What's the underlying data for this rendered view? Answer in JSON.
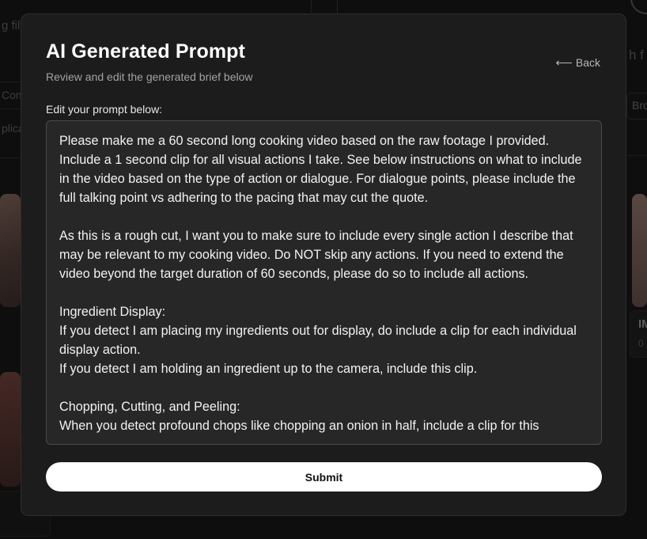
{
  "background": {
    "texts": [
      "g fil",
      "Con",
      "plica",
      "h f",
      "Bro",
      "IM",
      "0"
    ]
  },
  "modal": {
    "title": "AI Generated Prompt",
    "subtitle": "Review and edit the generated brief below",
    "back_label": "Back",
    "back_icon": "arrow-left-icon",
    "field_label": "Edit your prompt below:",
    "prompt_text": "Please make me a 60 second long cooking video based on the raw footage I provided. Include a 1 second clip for all visual actions I take. See below instructions on what to include in the video based on the type of action or dialogue. For dialogue points, please include the full talking point vs adhering to the pacing that may cut the quote.\n\nAs this is a rough cut, I want you to make sure to include every single action I describe that may be relevant to my cooking video. Do NOT skip any actions. If you need to extend the video beyond the target duration of 60 seconds, please do so to include all actions.\n\nIngredient Display:\nIf you detect I am placing my ingredients out for display, do include a clip for each individual display action.\nIf you detect I am holding an ingredient up to the camera, include this clip.\n\nChopping, Cutting, and Peeling:\nWhen you detect profound chops like chopping an onion in half, include a clip for this",
    "submit_label": "Submit"
  },
  "colors": {
    "modal_bg": "#1c1c1c",
    "textarea_bg": "#272727",
    "submit_bg": "#ffffff"
  }
}
